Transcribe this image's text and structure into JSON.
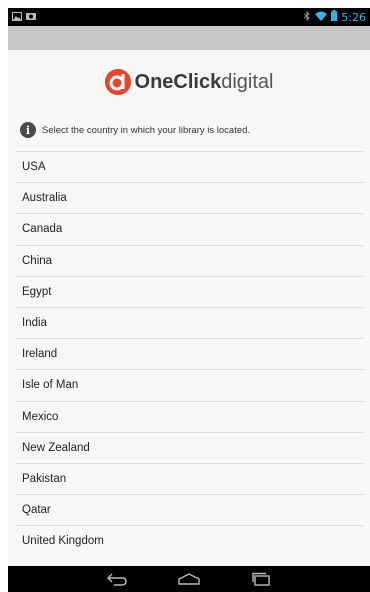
{
  "status_bar": {
    "time": "5:26",
    "left_icons": [
      "image-icon",
      "sync-icon"
    ],
    "right_icons": [
      "bluetooth-icon",
      "wifi-icon",
      "battery-icon"
    ]
  },
  "header": {
    "logo_text_bold": "OneClick",
    "logo_text_light": "digital",
    "logo_color": "#e8432c"
  },
  "prompt": {
    "text": "Select the country in which your library is located."
  },
  "countries": [
    "USA",
    "Australia",
    "Canada",
    "China",
    "Egypt",
    "India",
    "Ireland",
    "Isle of Man",
    "Mexico",
    "New Zealand",
    "Pakistan",
    "Qatar",
    "United Kingdom"
  ],
  "nav_bar": {
    "buttons": [
      "back-icon",
      "home-icon",
      "recents-icon"
    ]
  },
  "colors": {
    "status_accent": "#33b5e5",
    "actionbar_bg": "#c8c8c8"
  }
}
